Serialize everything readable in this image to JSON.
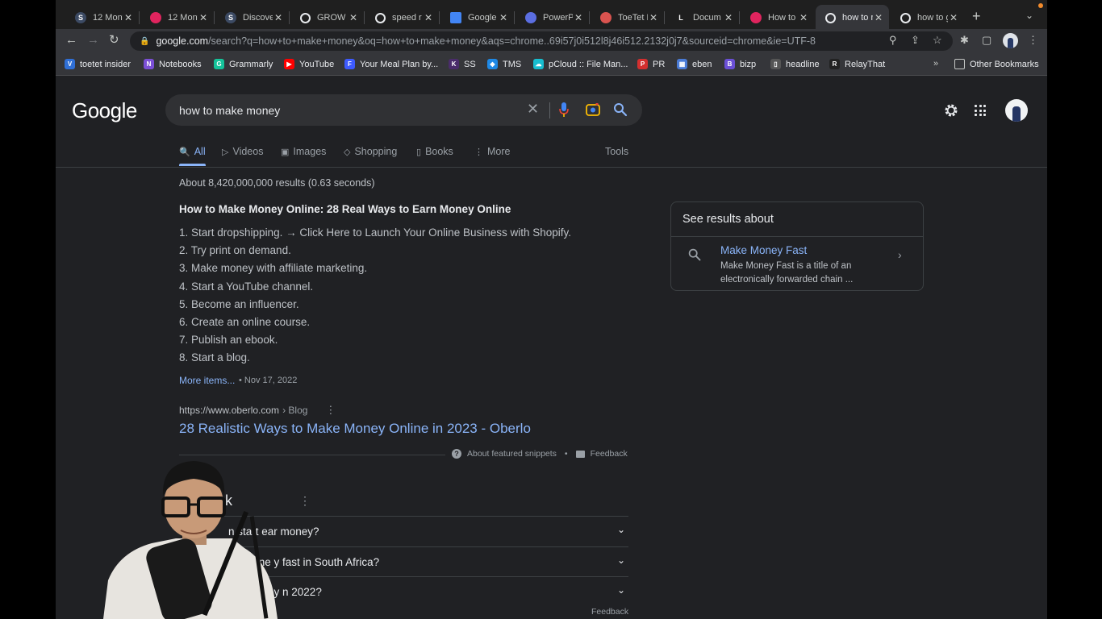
{
  "browser": {
    "tabs": [
      {
        "title": "12 Mont",
        "icon": "s-app-icon",
        "color": "#3c4a63",
        "glyph": "S",
        "active": false
      },
      {
        "title": "12 Mont",
        "icon": "record-icon",
        "color": "#e0245e",
        "glyph": "",
        "active": false
      },
      {
        "title": "Discove",
        "icon": "s-app-icon",
        "color": "#3c4a63",
        "glyph": "S",
        "active": false
      },
      {
        "title": "GROW",
        "icon": "google-icon",
        "color": "#e8eaed",
        "glyph": "G",
        "active": false
      },
      {
        "title": "speed r",
        "icon": "google-icon",
        "color": "#e8eaed",
        "glyph": "G",
        "active": false
      },
      {
        "title": "Google",
        "icon": "docs-icon",
        "color": "#4285f4",
        "glyph": "",
        "active": false
      },
      {
        "title": "PowerP",
        "icon": "powerpoint-icon",
        "color": "#5b6ee1",
        "glyph": "",
        "active": false
      },
      {
        "title": "ToeTet D",
        "icon": "toetet-icon",
        "color": "#d9534f",
        "glyph": "",
        "active": false
      },
      {
        "title": "Docum",
        "icon": "lm-icon",
        "color": "#ffffff",
        "glyph": "L",
        "active": false
      },
      {
        "title": "How to",
        "icon": "record-icon",
        "color": "#e0245e",
        "glyph": "",
        "active": false
      },
      {
        "title": "how to m",
        "icon": "google-icon",
        "color": "#e8eaed",
        "glyph": "G",
        "active": true
      },
      {
        "title": "how to g",
        "icon": "google-icon",
        "color": "#e8eaed",
        "glyph": "G",
        "active": false
      }
    ],
    "url_host": "google.com",
    "url_rest": "/search?q=how+to+make+money&oq=how+to+make+money&aqs=chrome..69i57j0i512l8j46i512.2132j0j7&sourceid=chrome&ie=UTF-8",
    "bookmarks": [
      {
        "label": "toetet insider",
        "color": "#2f6fd6",
        "glyph": "V"
      },
      {
        "label": "Notebooks",
        "color": "#7b4fd6",
        "glyph": "N"
      },
      {
        "label": "Grammarly",
        "color": "#15c39a",
        "glyph": "G"
      },
      {
        "label": "YouTube",
        "color": "#ff0000",
        "glyph": "▶"
      },
      {
        "label": "Your Meal Plan by...",
        "color": "#3d5afe",
        "glyph": "F"
      },
      {
        "label": "SS",
        "color": "#4a2c6b",
        "glyph": "K"
      },
      {
        "label": "TMS",
        "color": "#1e88e5",
        "glyph": "◆"
      },
      {
        "label": "pCloud :: File Man...",
        "color": "#17bed0",
        "glyph": "☁"
      },
      {
        "label": "PR",
        "color": "#d32f2f",
        "glyph": "P"
      },
      {
        "label": "eben",
        "color": "#4a7bd6",
        "glyph": "▦"
      },
      {
        "label": "bizp",
        "color": "#6a4fd6",
        "glyph": "B"
      },
      {
        "label": "headline",
        "color": "#555555",
        "glyph": "▯"
      },
      {
        "label": "RelayThat",
        "color": "#222222",
        "glyph": "R"
      }
    ],
    "bookmarks_overflow": "»",
    "other_bookmarks": "Other Bookmarks"
  },
  "google": {
    "logo": "Google",
    "query": "how to make money",
    "tabs": [
      {
        "label": "All",
        "icon": "search-icon",
        "glyph": "🔍",
        "active": true
      },
      {
        "label": "Videos",
        "icon": "video-icon",
        "glyph": "▷",
        "active": false
      },
      {
        "label": "Images",
        "icon": "image-icon",
        "glyph": "▣",
        "active": false
      },
      {
        "label": "Shopping",
        "icon": "tag-icon",
        "glyph": "◇",
        "active": false
      },
      {
        "label": "Books",
        "icon": "book-icon",
        "glyph": "▯",
        "active": false
      },
      {
        "label": "More",
        "icon": "more-vert-icon",
        "glyph": "⋮",
        "active": false
      }
    ],
    "tools_label": "Tools",
    "result_stats": "About 8,420,000,000 results (0.63 seconds)",
    "snippet": {
      "title": "How to Make Money Online: 28 Real Ways to Earn Money Online",
      "items": [
        "1. Start dropshipping. → Click Here to Launch Your Online Business with Shopify.",
        "2. Try print on demand.",
        "3. Make money with affiliate marketing.",
        "4. Start a YouTube channel.",
        "5. Become an influencer.",
        "6. Create an online course.",
        "7. Publish an ebook.",
        "8. Start a blog."
      ],
      "more_items": "More items...",
      "date": "• Nov 17, 2022",
      "cite_url": "https://www.oberlo.com",
      "cite_crumb": "› Blog",
      "link": "28 Realistic Ways to Make Money Online in 2023 - Oberlo",
      "about_label": "About featured snippets",
      "separator": "•",
      "feedback_label": "Feedback"
    },
    "paa": {
      "title": "also ask",
      "questions": [
        "n start ear       money?",
        "mone  y   fast in South Africa?",
        "oney  n 2022?"
      ],
      "feedback_label": "Feedback"
    },
    "aside": {
      "title": "See results about",
      "link": "Make Money Fast",
      "description": "Make Money Fast is a title of an electronically forwarded chain ..."
    }
  }
}
